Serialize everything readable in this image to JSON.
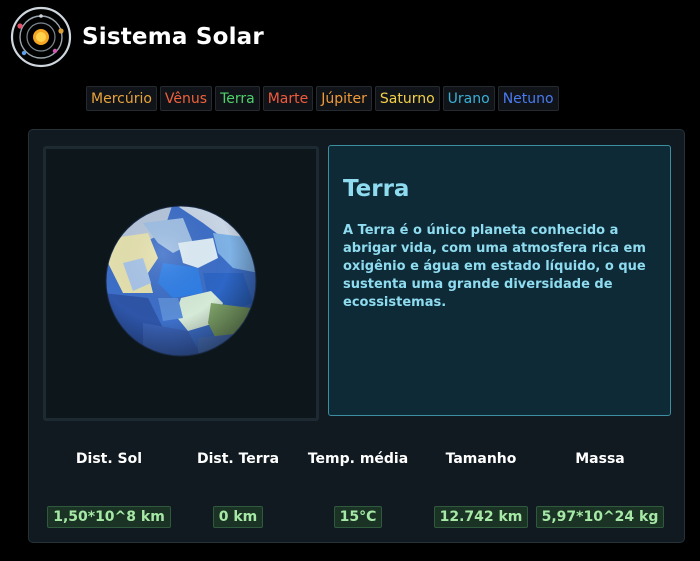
{
  "app": {
    "title": "Sistema Solar",
    "logo_icon": "solar-system-icon"
  },
  "nav": {
    "items": [
      {
        "label": "Mercúrio",
        "color": "#e8a33a"
      },
      {
        "label": "Vênus",
        "color": "#f0603c"
      },
      {
        "label": "Terra",
        "color": "#4fd06a"
      },
      {
        "label": "Marte",
        "color": "#f05a3c"
      },
      {
        "label": "Júpiter",
        "color": "#f09a3a"
      },
      {
        "label": "Saturno",
        "color": "#f4d04a"
      },
      {
        "label": "Urano",
        "color": "#3ab0d8"
      },
      {
        "label": "Netuno",
        "color": "#4a7af0"
      }
    ]
  },
  "planet": {
    "name": "Terra",
    "description": "A Terra é o único planeta conhecido a abrigar vida, com uma atmosfera rica em oxigênio e água em estado líquido, o que sustenta uma grande diversidade de ecossistemas.",
    "image_icon": "earth-planet-icon"
  },
  "stats": [
    {
      "label": "Dist. Sol",
      "value": "1,50*10^8 km"
    },
    {
      "label": "Dist. Terra",
      "value": "0 km"
    },
    {
      "label": "Temp. média",
      "value": "15°C"
    },
    {
      "label": "Tamanho",
      "value": "12.742 km"
    },
    {
      "label": "Massa",
      "value": "5,97*10^24 kg"
    }
  ],
  "colors": {
    "accent": "#8fdcf0",
    "stat_value": "#a6e8a6",
    "panel": "#101a20"
  }
}
